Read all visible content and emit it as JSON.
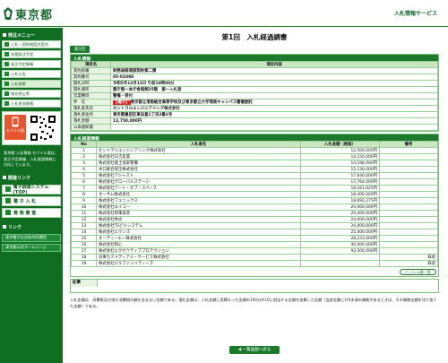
{
  "header": {
    "logo_text": "東京都",
    "service": "入札情報サービス"
  },
  "sidebar": {
    "section_menu": "発注メニュー",
    "items": [
      "入札・契約制度の案内",
      "年間発注予定",
      "発注予定情報",
      "入札公告",
      "入札結果",
      "指名停止等",
      "入札参加資格"
    ],
    "mobile_badge": "モバイル版",
    "mobile_text": "東京都 入札情報 モバイル版は、発注予定情報、入札経過情報に対応しています。",
    "section_links": "関連リンク",
    "big_buttons": [
      "電子調達システム(TOP)",
      "電 子 入 札",
      "資 格 審 査"
    ],
    "section_other": "リンク",
    "green_links": [
      "東京電子自治体共同運営",
      "東京都公式ホームページ"
    ]
  },
  "main": {
    "title": "第1回　入札経過調書",
    "tab": "第1回",
    "bid_info_header": "入札情報",
    "bid_info_cols": [
      "項目名",
      "項目内容"
    ],
    "bid_info": [
      {
        "k": "契約部署",
        "v": "財務局経理部契約第二課"
      },
      {
        "k": "契約番号",
        "v": "05-01098"
      },
      {
        "k": "開札日時",
        "v": "令和5年12月13日 午前10時00分"
      },
      {
        "k": "開札場所",
        "v": "都庁第一本庁舎南側25階　第一入札室"
      },
      {
        "k": "営業種目",
        "v": "警備・受付"
      },
      {
        "k": "件　名",
        "tag": "【電子】",
        "v": "東京都立港南総合高等学校及び東京都立大学港南キャンパス警備委託"
      },
      {
        "k": "落札者氏名",
        "v": "セントラルエンジニアリング株式会社"
      },
      {
        "k": "落札者住所",
        "v": "東京都墨田区東向島1丁目2番2号"
      },
      {
        "k": "落札金額",
        "v": "13,750,000円"
      },
      {
        "k": "公表通知書",
        "v": ""
      }
    ],
    "progress_header": "入札経過情報",
    "progress_cols": [
      "No",
      "入札者名",
      "入札金額（税抜）",
      "備考"
    ],
    "bidders": [
      {
        "no": "1",
        "name": "セントラルエンジニアリング株式会社",
        "amount": "12,500,000円",
        "note": ""
      },
      {
        "no": "2",
        "name": "株式会社日吉産業",
        "amount": "14,150,000円",
        "note": ""
      },
      {
        "no": "3",
        "name": "株式会社富士保安警備",
        "amount": "14,196,000円",
        "note": ""
      },
      {
        "no": "4",
        "name": "木口総合保全株式会社",
        "amount": "15,130,000円",
        "note": ""
      },
      {
        "no": "5",
        "name": "株式会社アジャスト",
        "amount": "17,640,000円",
        "note": ""
      },
      {
        "no": "6",
        "name": "株式会社グローバルステージ",
        "amount": "17,764,000円",
        "note": ""
      },
      {
        "no": "7",
        "name": "株式会社アート・オブ・スペース",
        "amount": "18,161,625円",
        "note": ""
      },
      {
        "no": "8",
        "name": "オーサム株式会社",
        "amount": "18,400,000円",
        "note": ""
      },
      {
        "no": "9",
        "name": "株式会社フェニックス",
        "amount": "18,692,275円",
        "note": ""
      },
      {
        "no": "10",
        "name": "株式会社エイコー",
        "amount": "20,000,000円",
        "note": ""
      },
      {
        "no": "11",
        "name": "株式会社新東美装",
        "amount": "20,400,000円",
        "note": ""
      },
      {
        "no": "12",
        "name": "株式会社秀光",
        "amount": "24,000,000円",
        "note": ""
      },
      {
        "no": "13",
        "name": "株式会社TSビルシステム",
        "amount": "24,000,000円",
        "note": ""
      },
      {
        "no": "14",
        "name": "株式会社エクシズ",
        "amount": "25,000,000円",
        "note": ""
      },
      {
        "no": "15",
        "name": "オーディーエー株式会社",
        "amount": "28,233,000円",
        "note": ""
      },
      {
        "no": "16",
        "name": "株式会社和心",
        "amount": "40,000,000円",
        "note": ""
      },
      {
        "no": "17",
        "name": "株式会社エグゼクティブプロテクション",
        "amount": "93,500,000円",
        "note": ""
      },
      {
        "no": "18",
        "name": "日東カストディアル・サービス株式会社",
        "amount": "",
        "note": "辞退"
      },
      {
        "no": "19",
        "name": "株式会社ＯＳファシリティーズ",
        "amount": "",
        "note": "辞退"
      }
    ],
    "notice_button": "ハッシュ値一覧",
    "remarks_label": "記事",
    "footnote": "入札金額は、消費税及び地方消費税の額を含まない金額である。落札金額は、入札金額に見積もった金額の100分の10に相当する金額を加算した金額（当該金額に1円未満の端数があるときは、その端数金額を切り捨てた金額）である。",
    "back_button": "◀ 一覧画面へ戻る"
  }
}
